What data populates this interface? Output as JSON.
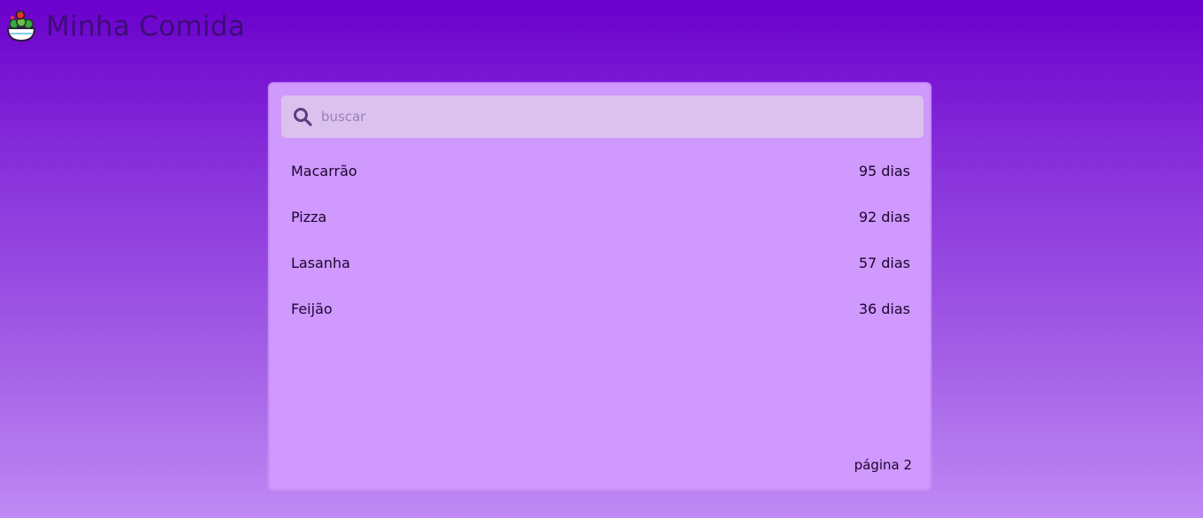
{
  "app": {
    "title": "Minha Comida",
    "logo_icon": "salad-bowl-icon"
  },
  "search": {
    "placeholder": "buscar",
    "value": "",
    "icon": "search-icon"
  },
  "items": [
    {
      "name": "Macarrão",
      "days": "95 dias"
    },
    {
      "name": "Pizza",
      "days": "92 dias"
    },
    {
      "name": "Lasanha",
      "days": "57 dias"
    },
    {
      "name": "Feijão",
      "days": "36 dias"
    }
  ],
  "pagination": {
    "label": "página 2"
  },
  "colors": {
    "background_top": "#6a00cc",
    "background_bottom": "#bf8af3",
    "card": "#cf99fd",
    "search_field": "#dbc2ee",
    "title": "#3d0c78"
  }
}
